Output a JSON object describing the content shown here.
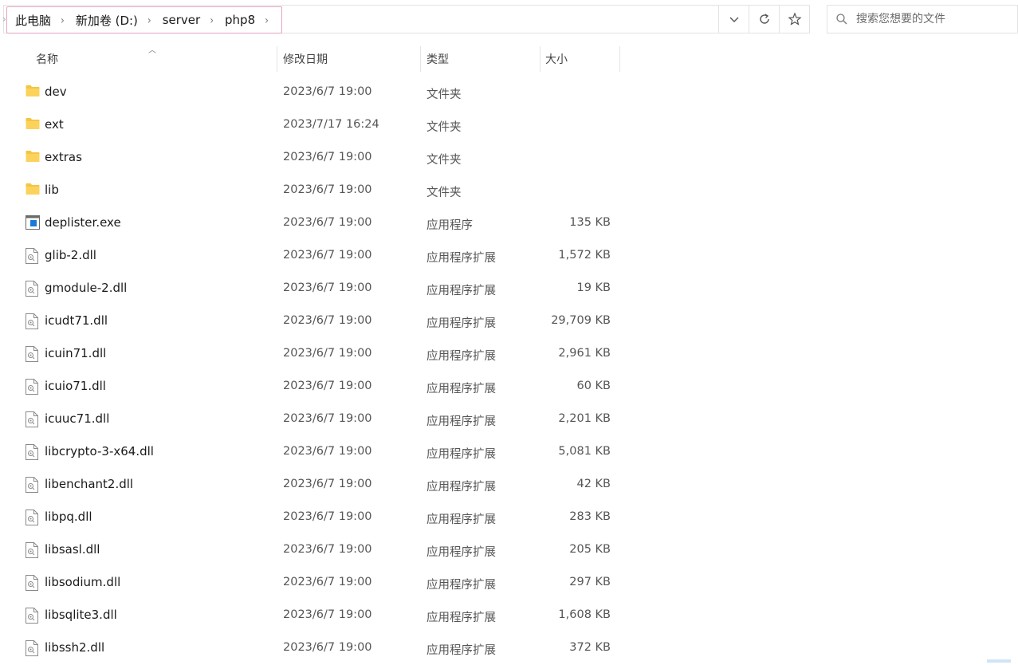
{
  "breadcrumb": [
    "此电脑",
    "新加卷 (D:)",
    "server",
    "php8"
  ],
  "search": {
    "placeholder": "搜索您想要的文件"
  },
  "columns": {
    "name": "名称",
    "date": "修改日期",
    "type": "类型",
    "size": "大小"
  },
  "files": [
    {
      "name": "dev",
      "date": "2023/6/7 19:00",
      "type": "文件夹",
      "size": "",
      "icon": "folder-icon"
    },
    {
      "name": "ext",
      "date": "2023/7/17 16:24",
      "type": "文件夹",
      "size": "",
      "icon": "folder-icon"
    },
    {
      "name": "extras",
      "date": "2023/6/7 19:00",
      "type": "文件夹",
      "size": "",
      "icon": "folder-icon"
    },
    {
      "name": "lib",
      "date": "2023/6/7 19:00",
      "type": "文件夹",
      "size": "",
      "icon": "folder-icon"
    },
    {
      "name": "deplister.exe",
      "date": "2023/6/7 19:00",
      "type": "应用程序",
      "size": "135 KB",
      "icon": "exe-icon"
    },
    {
      "name": "glib-2.dll",
      "date": "2023/6/7 19:00",
      "type": "应用程序扩展",
      "size": "1,572 KB",
      "icon": "dll-icon"
    },
    {
      "name": "gmodule-2.dll",
      "date": "2023/6/7 19:00",
      "type": "应用程序扩展",
      "size": "19 KB",
      "icon": "dll-icon"
    },
    {
      "name": "icudt71.dll",
      "date": "2023/6/7 19:00",
      "type": "应用程序扩展",
      "size": "29,709 KB",
      "icon": "dll-icon"
    },
    {
      "name": "icuin71.dll",
      "date": "2023/6/7 19:00",
      "type": "应用程序扩展",
      "size": "2,961 KB",
      "icon": "dll-icon"
    },
    {
      "name": "icuio71.dll",
      "date": "2023/6/7 19:00",
      "type": "应用程序扩展",
      "size": "60 KB",
      "icon": "dll-icon"
    },
    {
      "name": "icuuc71.dll",
      "date": "2023/6/7 19:00",
      "type": "应用程序扩展",
      "size": "2,201 KB",
      "icon": "dll-icon"
    },
    {
      "name": "libcrypto-3-x64.dll",
      "date": "2023/6/7 19:00",
      "type": "应用程序扩展",
      "size": "5,081 KB",
      "icon": "dll-icon"
    },
    {
      "name": "libenchant2.dll",
      "date": "2023/6/7 19:00",
      "type": "应用程序扩展",
      "size": "42 KB",
      "icon": "dll-icon"
    },
    {
      "name": "libpq.dll",
      "date": "2023/6/7 19:00",
      "type": "应用程序扩展",
      "size": "283 KB",
      "icon": "dll-icon"
    },
    {
      "name": "libsasl.dll",
      "date": "2023/6/7 19:00",
      "type": "应用程序扩展",
      "size": "205 KB",
      "icon": "dll-icon"
    },
    {
      "name": "libsodium.dll",
      "date": "2023/6/7 19:00",
      "type": "应用程序扩展",
      "size": "297 KB",
      "icon": "dll-icon"
    },
    {
      "name": "libsqlite3.dll",
      "date": "2023/6/7 19:00",
      "type": "应用程序扩展",
      "size": "1,608 KB",
      "icon": "dll-icon"
    },
    {
      "name": "libssh2.dll",
      "date": "2023/6/7 19:00",
      "type": "应用程序扩展",
      "size": "372 KB",
      "icon": "dll-icon"
    }
  ],
  "colors": {
    "folder": "#f5c542",
    "accent": "#0067c0",
    "breadcrumb_highlight": "#e6a3c6"
  }
}
